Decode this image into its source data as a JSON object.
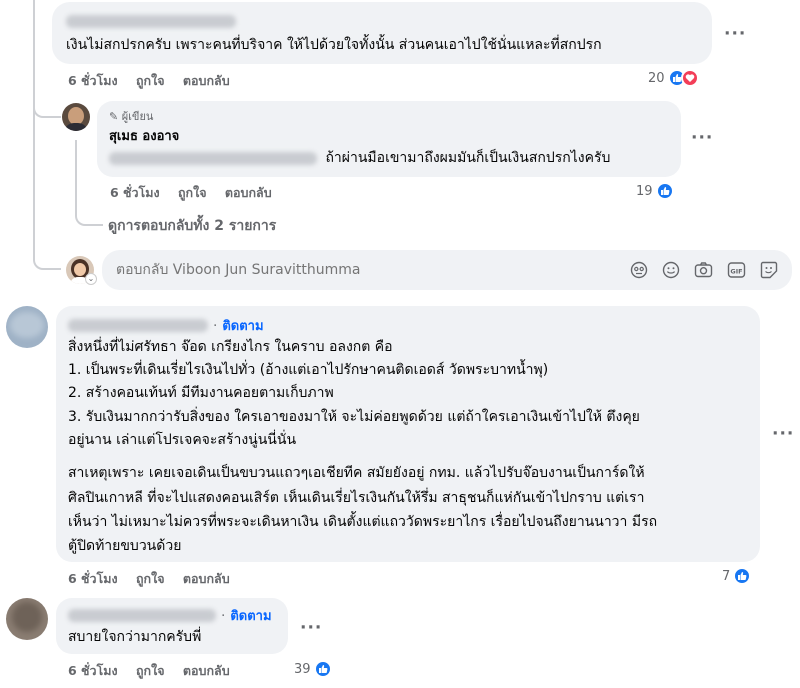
{
  "comment1": {
    "text": "เงินไม่สกปรกครับ เพราะคนที่บริจาค ให้ไปด้วยใจทั้งนั้น ส่วนคนเอาไปใช้นั่นแหละที่สกปรก",
    "time": "6 ชั่วโมง",
    "like": "ถูกใจ",
    "reply": "ตอบกลับ",
    "reaction_count": "20",
    "reaction_icons": [
      "like-icon",
      "heart-icon"
    ]
  },
  "reply1": {
    "author_badge": "ผู้เขียน",
    "author_name": "สุเมธ องอาจ",
    "text": "ถ้าผ่านมือเขามาถึงผมมันก็เป็นเงินสกปรกไงครับ",
    "time": "6 ชั่วโมง",
    "like": "ถูกใจ",
    "reply": "ตอบกลับ",
    "reaction_count": "19"
  },
  "view_replies": "ดูการตอบกลับทั้ง 2 รายการ",
  "reply_box": {
    "placeholder": "ตอบกลับ Viboon Jun Suravitthumma",
    "icons": [
      "avatar-icon",
      "smile-icon",
      "camera-icon",
      "gif-icon",
      "sticker-icon"
    ]
  },
  "comment2": {
    "follow": "ติดตาม",
    "lines": [
      "สิ่งหนึ่งที่ไม่ศรัทธา จ๊อด เกรียงไกร ในคราบ อลงกต คือ",
      "1. เป็นพระที่เดินเรี่ยไรเงินไปทั่ว (อ้างแต่เอาไปรักษาคนติดเอดส์ วัดพระบาทน้ำพุ)",
      "2. สร้างคอนเท้นท์ มีทีมงานคอยตามเก็บภาพ",
      "3. รับเงินมากกว่ารับสิ่งของ ใครเอาของมาให้ จะไม่ค่อยพูดด้วย แต่ถ้าใครเอาเงินเข้าไปให้ ตึงคุย",
      "อยู่นาน เล่าแต่โปรเจคจะสร้างนู่นนี่นั่น"
    ],
    "lines2": [
      "สาเหตุเพราะ เคยเจอเดินเป็นขบวนแถวๆเอเชียทีค สมัยยังอยู่ กทม. แล้วไปรับจ๊อบงานเป็นการ์ดให้",
      "ศิลปินเกาหลี ที่จะไปแสดงคอนเสิร์ต เห็นเดินเรี่ยไรเงินกันให้รึ่ม สาธุชนก็แห่กันเข้าไปกราบ แต่เรา",
      "เห็นว่า ไม่เหมาะไม่ควรที่พระจะเดินหาเงิน เดินตั้งแต่แถววัดพระยาไกร เรื่อยไปจนถึงยานนาวา มีรถ",
      "ตู้ปิดท้ายขบวนด้วย"
    ],
    "time": "6 ชั่วโมง",
    "like": "ถูกใจ",
    "reply": "ตอบกลับ",
    "reaction_count": "7"
  },
  "comment3": {
    "follow": "ติดตาม",
    "text": "สบายใจกว่ามากครับพี่",
    "time": "6 ชั่วโมง",
    "like": "ถูกใจ",
    "reply": "ตอบกลับ",
    "reaction_count": "39"
  },
  "more_icon": "more-options-icon",
  "colors": {
    "like_blue": "#1877f2",
    "follow_blue": "#0866ff",
    "bubble_bg": "#f0f2f5",
    "meta_gray": "#65676b"
  }
}
